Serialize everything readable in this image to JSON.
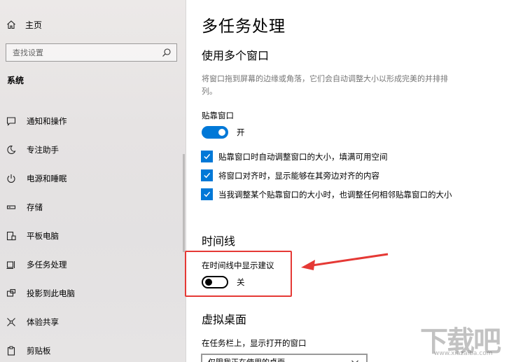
{
  "sidebar": {
    "home_label": "主页",
    "search_placeholder": "查找设置",
    "section_title": "系统",
    "items": [
      {
        "label": "通知和操作",
        "icon": "notification-icon"
      },
      {
        "label": "专注助手",
        "icon": "moon-icon"
      },
      {
        "label": "电源和睡眠",
        "icon": "power-icon"
      },
      {
        "label": "存储",
        "icon": "storage-icon"
      },
      {
        "label": "平板电脑",
        "icon": "tablet-icon"
      },
      {
        "label": "多任务处理",
        "icon": "multitasking-icon"
      },
      {
        "label": "投影到此电脑",
        "icon": "projection-icon"
      },
      {
        "label": "体验共享",
        "icon": "share-icon"
      },
      {
        "label": "剪贴板",
        "icon": "clipboard-icon"
      }
    ]
  },
  "main": {
    "title": "多任务处理",
    "windows_section": {
      "heading": "使用多个窗口",
      "description": "将窗口拖到屏幕的边缘或角落，它们会自动调整大小以形成完美的并排排列。",
      "snap_label": "贴靠窗口",
      "snap_toggle_state": "开",
      "checkboxes": [
        "贴靠窗口时自动调整窗口的大小，填满可用空间",
        "将窗口对齐时，显示能够在其旁边对齐的内容",
        "当我调整某个贴靠窗口的大小时，也调整任何相邻贴靠窗口的大小"
      ]
    },
    "timeline_section": {
      "heading": "时间线",
      "suggestions_label": "在时间线中显示建议",
      "suggestions_toggle_state": "关"
    },
    "virtual_desktop_section": {
      "heading": "虚拟桌面",
      "taskbar_label": "在任务栏上，显示打开的窗口",
      "dropdown_value": "仅限我正在使用的桌面"
    }
  },
  "watermark": {
    "text": "下载吧",
    "subtext": "www.xiazaiba.com"
  },
  "colors": {
    "accent": "#0078d7",
    "annotation": "#e53935"
  }
}
